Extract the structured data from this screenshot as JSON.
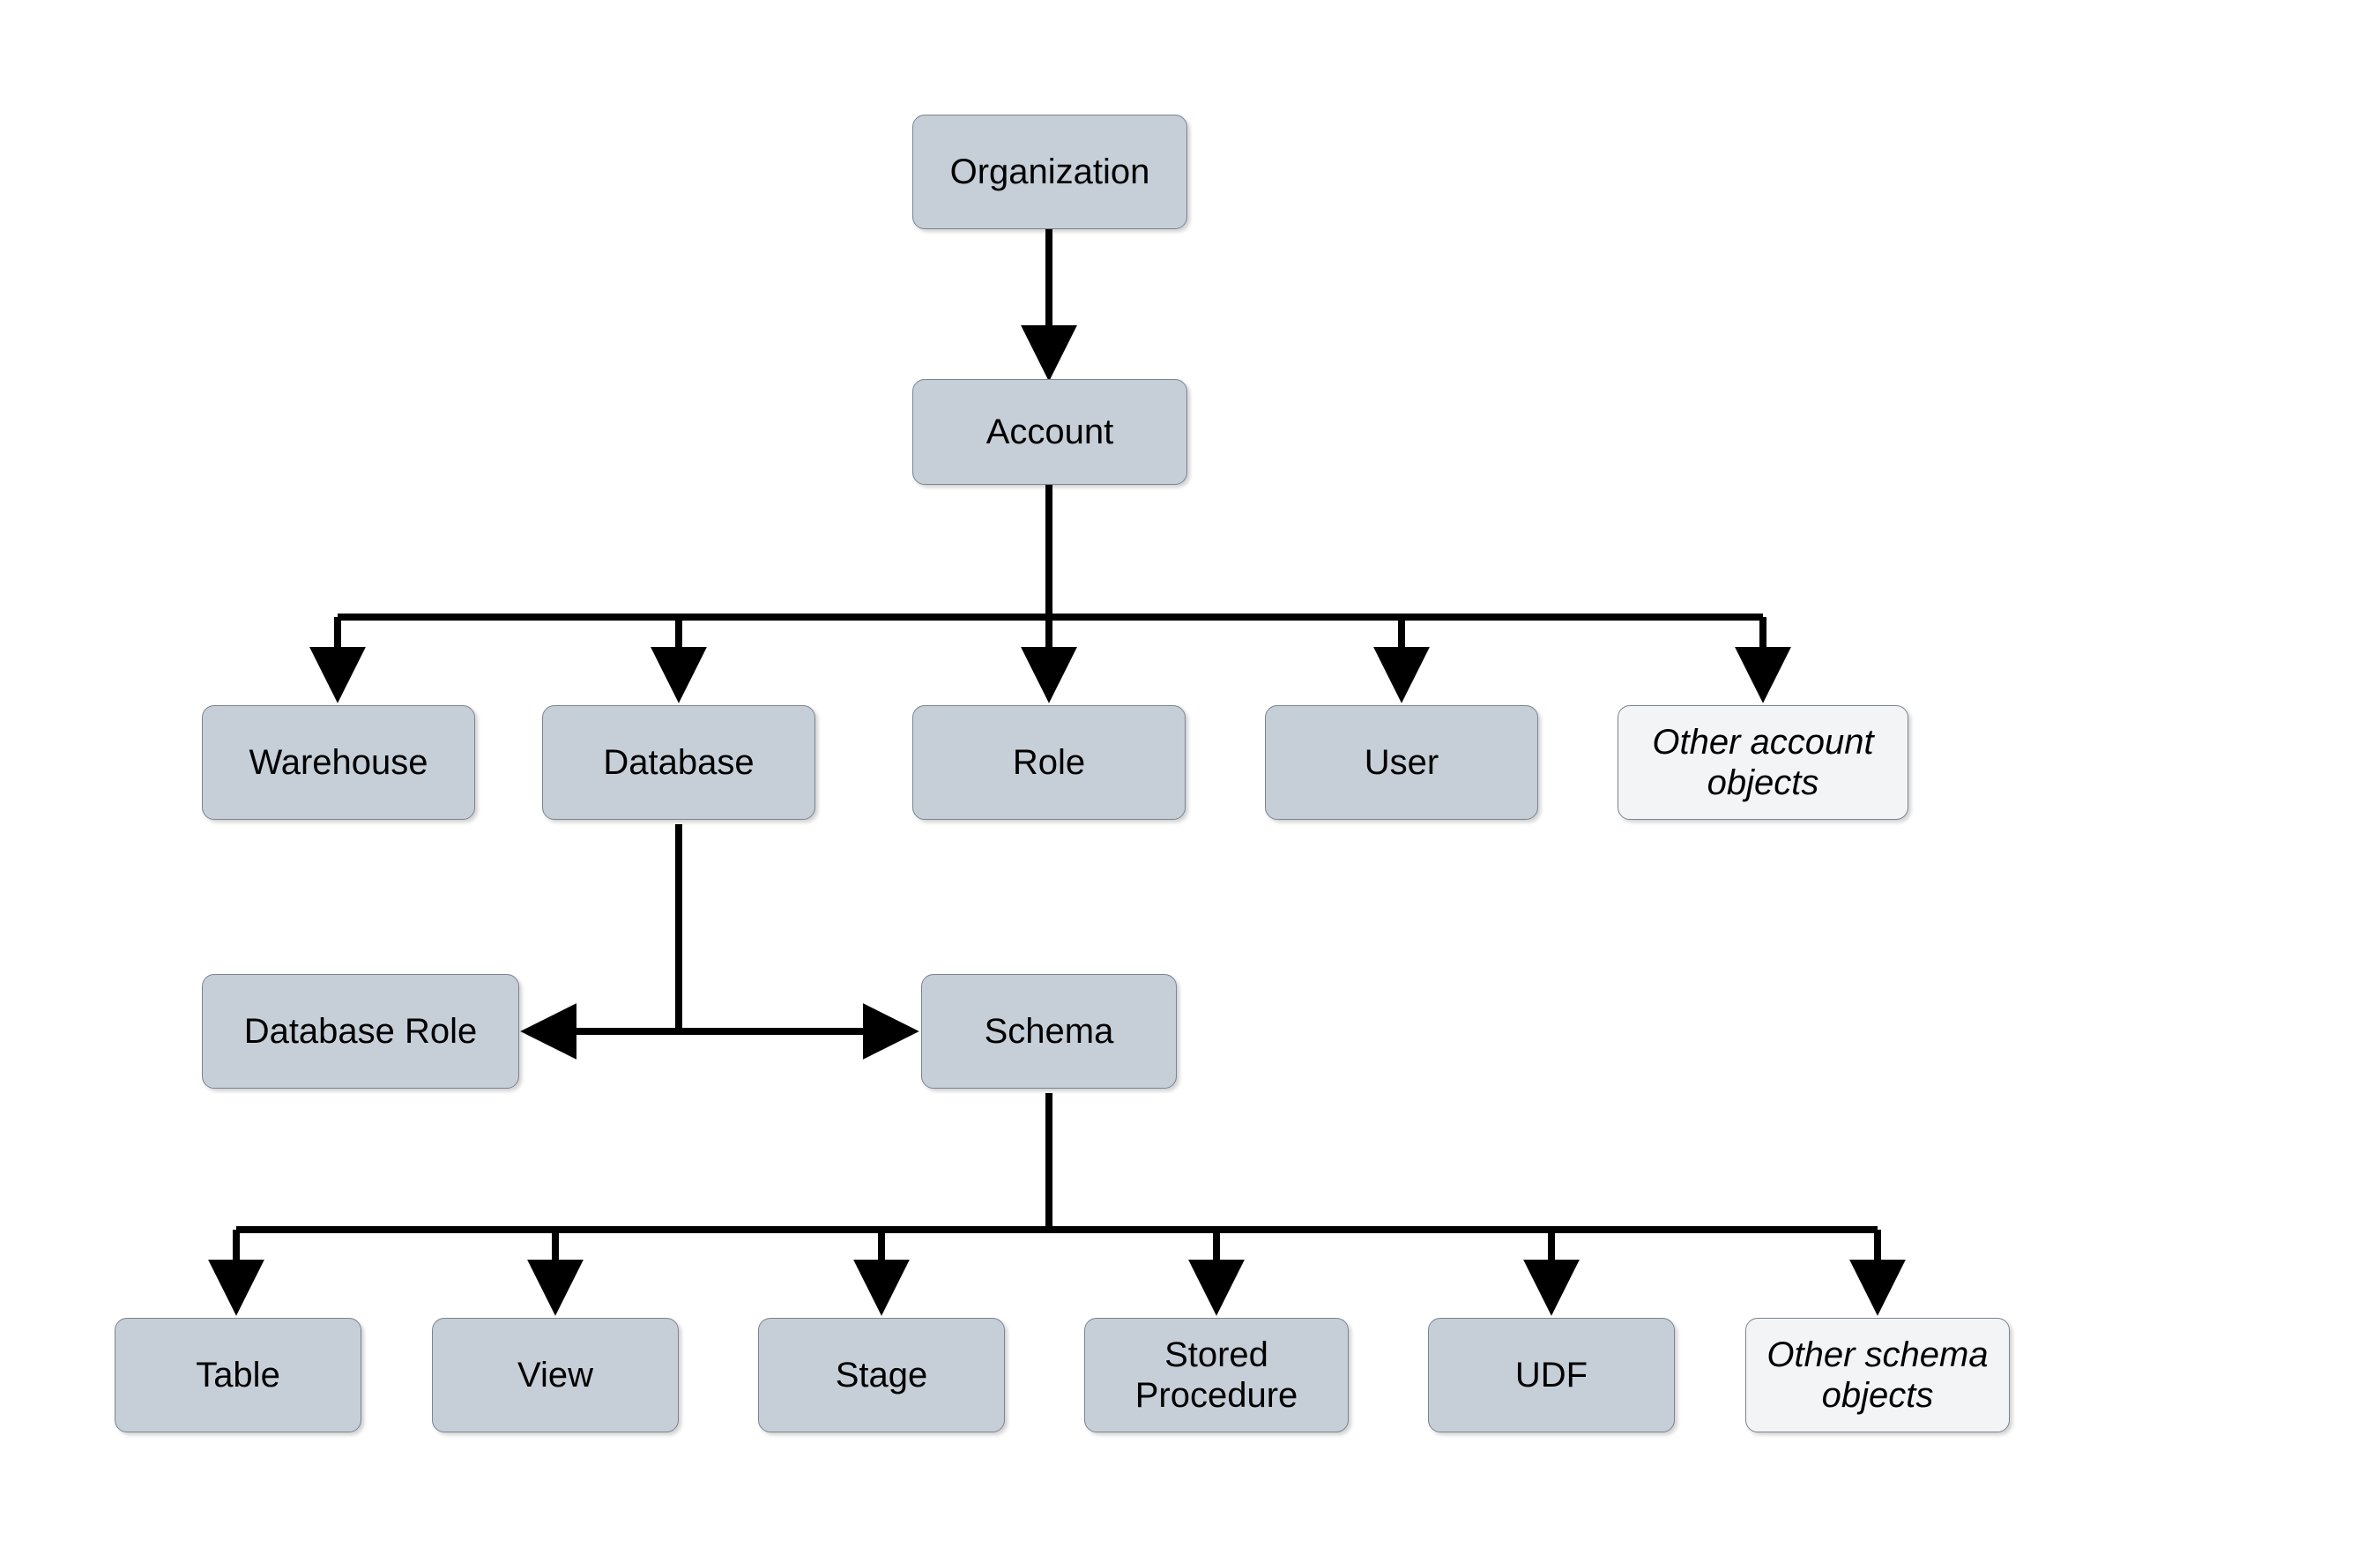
{
  "nodes": {
    "organization": "Organization",
    "account": "Account",
    "warehouse": "Warehouse",
    "database": "Database",
    "role": "Role",
    "user": "User",
    "other_account": "Other account objects",
    "database_role": "Database Role",
    "schema": "Schema",
    "table": "Table",
    "view": "View",
    "stage": "Stage",
    "stored_procedure": "Stored Procedure",
    "udf": "UDF",
    "other_schema": "Other schema objects"
  },
  "diagram_type": "hierarchy",
  "description": "Object hierarchy: Organization → Account → {Warehouse, Database, Role, User, Other account objects}; Database → {Database Role, Schema}; Schema → {Table, View, Stage, Stored Procedure, UDF, Other schema objects}"
}
